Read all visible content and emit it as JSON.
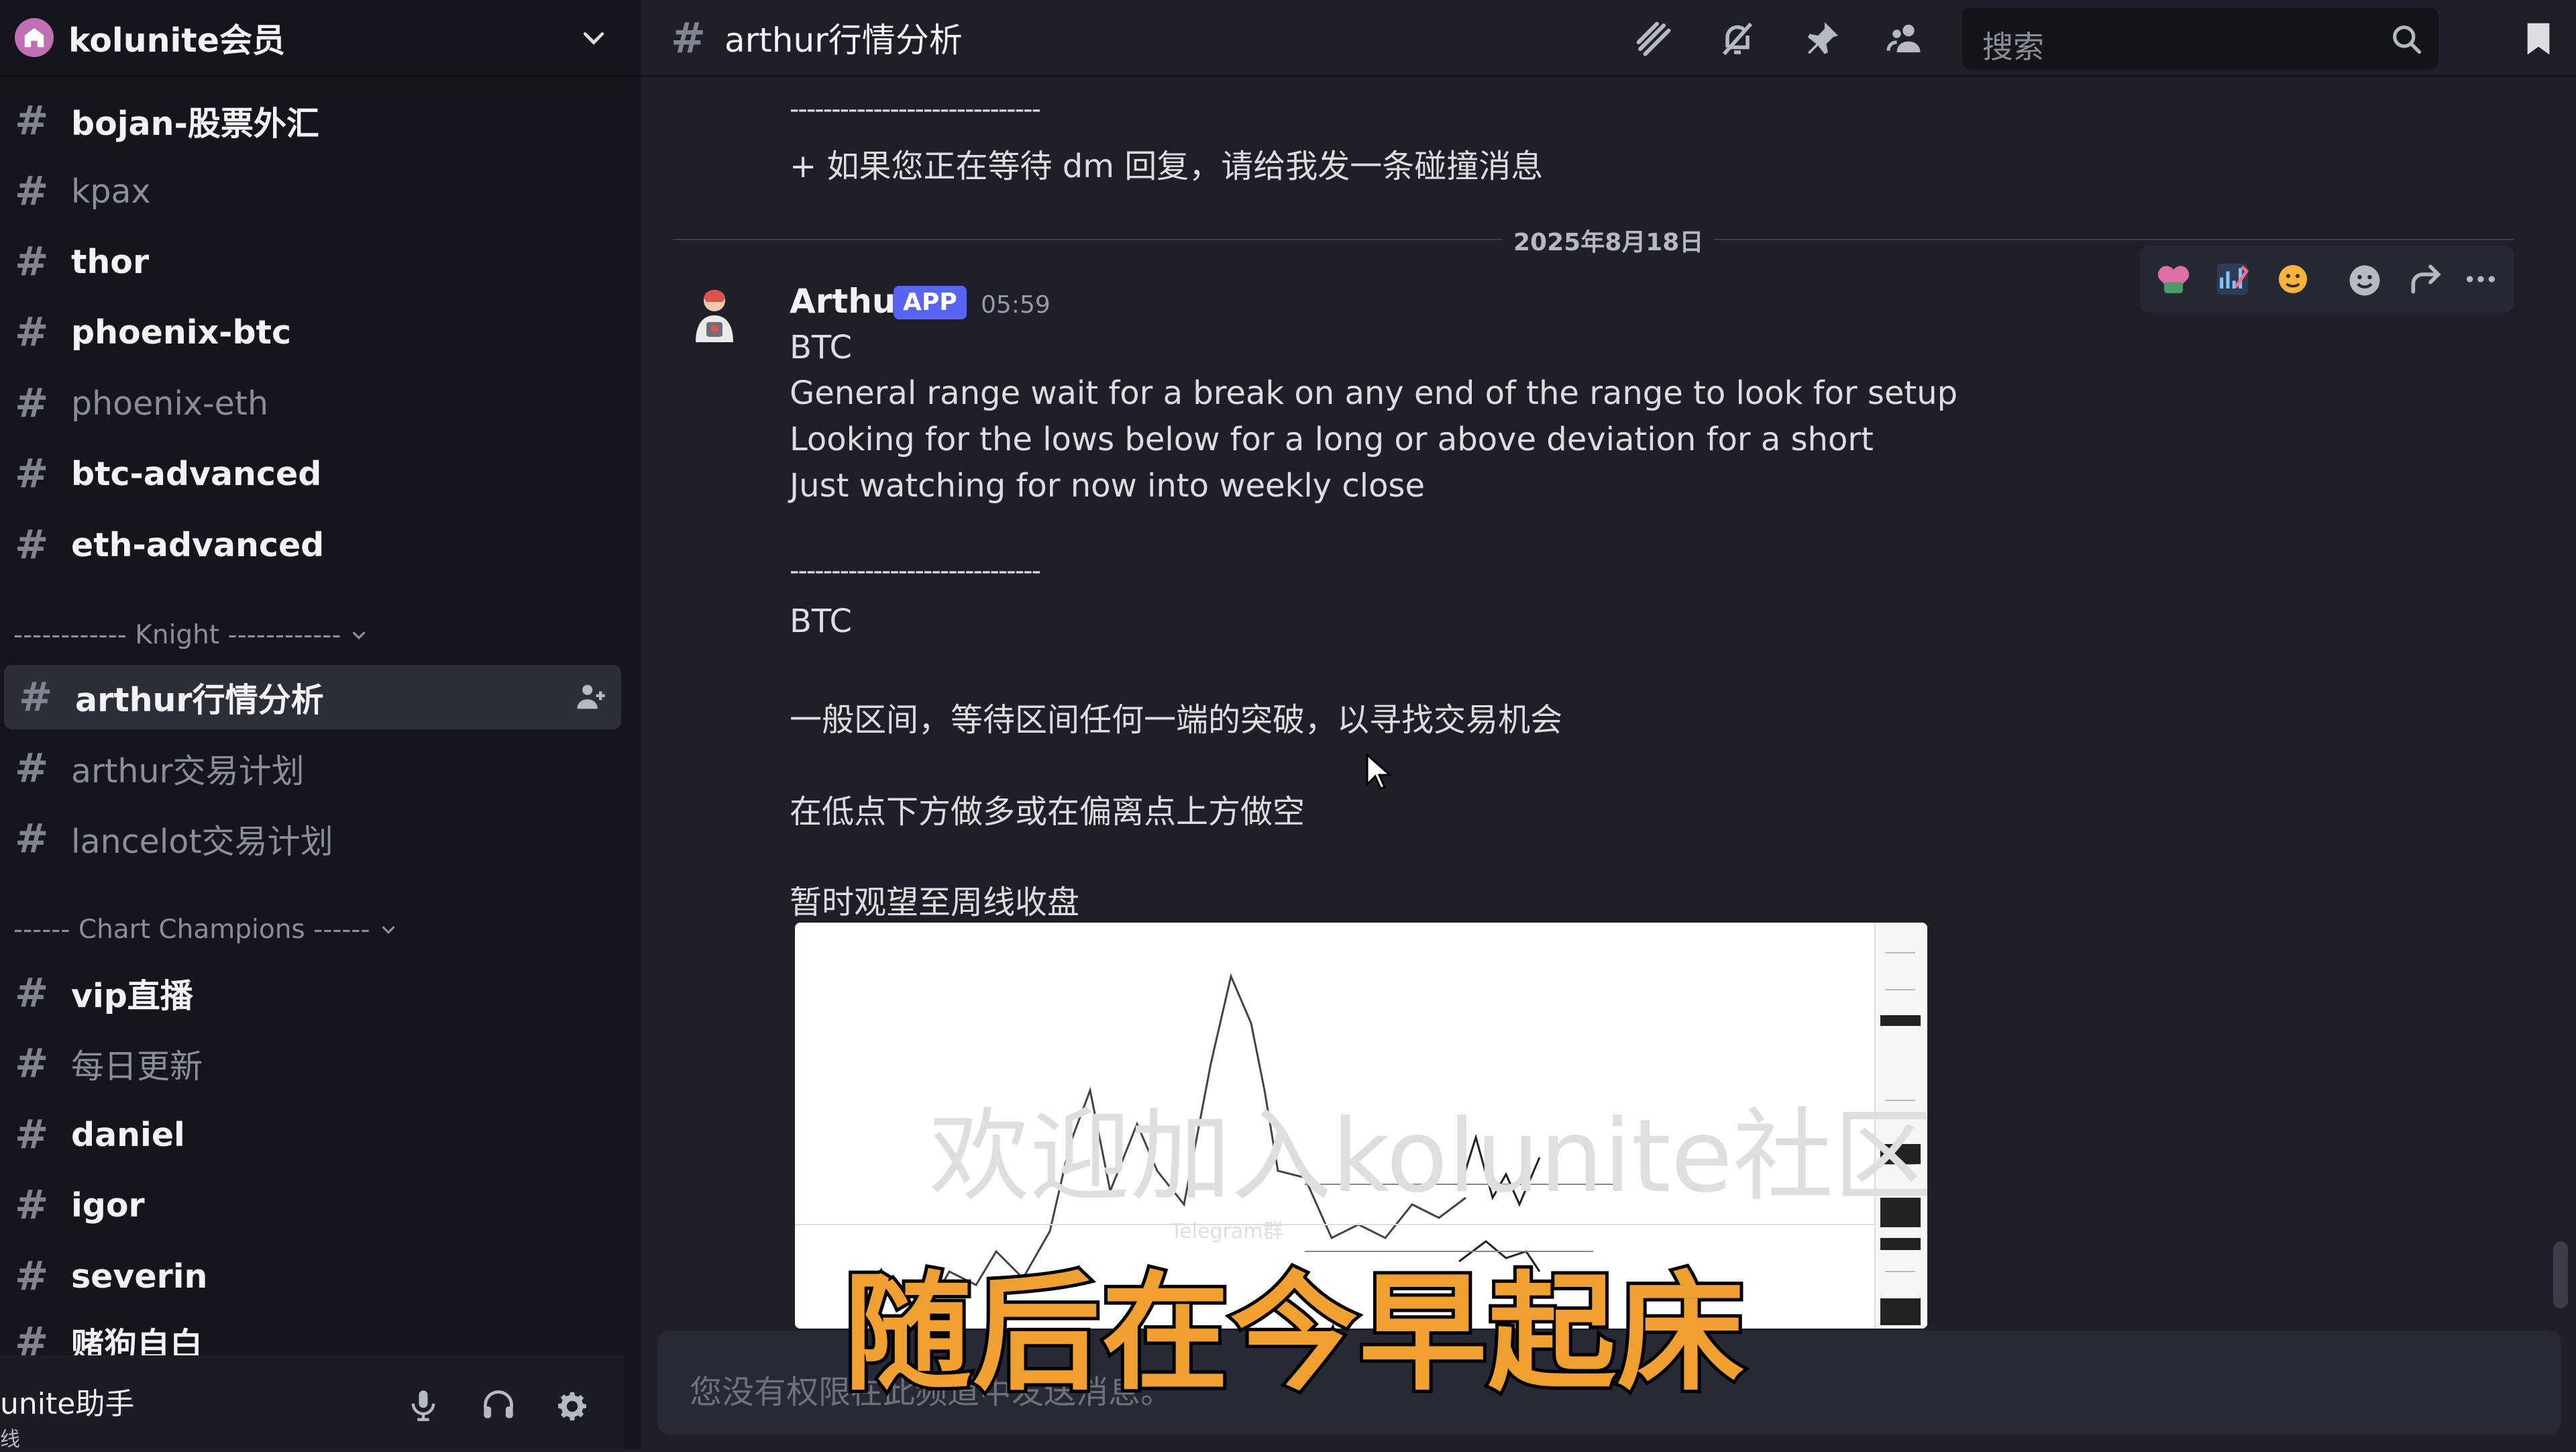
{
  "server": {
    "name": "kolunite会员"
  },
  "sidebar": {
    "channels_top": [
      {
        "label": "bojan-股票外汇",
        "state": "unread"
      },
      {
        "label": "kpax",
        "state": "read"
      },
      {
        "label": "thor",
        "state": "unread"
      },
      {
        "label": "phoenix-btc",
        "state": "unread"
      },
      {
        "label": "phoenix-eth",
        "state": "read"
      },
      {
        "label": "btc-advanced",
        "state": "unread"
      },
      {
        "label": "eth-advanced",
        "state": "unread"
      }
    ],
    "category_knight": "------------ Knight ------------",
    "channels_knight": [
      {
        "label": "arthur行情分析",
        "state": "active"
      },
      {
        "label": "arthur交易计划",
        "state": "read"
      },
      {
        "label": "lancelot交易计划",
        "state": "read"
      }
    ],
    "category_cc": "------ Chart Champions ------",
    "channels_cc": [
      {
        "label": "vip直播",
        "state": "unread"
      },
      {
        "label": "每日更新",
        "state": "read"
      },
      {
        "label": "daniel",
        "state": "unread"
      },
      {
        "label": "igor",
        "state": "unread"
      },
      {
        "label": "severin",
        "state": "unread"
      },
      {
        "label": "赌狗自白",
        "state": "unread"
      }
    ]
  },
  "user_panel": {
    "name": "unite助手",
    "status": "线"
  },
  "header": {
    "channel_name": "arthur行情分析",
    "search_placeholder": "搜索"
  },
  "messages": {
    "prev_separator": "------------------------------",
    "prev_line": "+ 如果您正在等待 dm 回复，请给我发一条碰撞消息",
    "date_divider": "2025年8月18日",
    "author": "Arthur",
    "badge": "APP",
    "time": "05:59",
    "lines_en": [
      "BTC",
      "General range wait for a break on any end of the range to look for setup",
      "Looking for the lows below for a long or above deviation for a short",
      "Just watching for now into weekly close"
    ],
    "separator": "------------------------------",
    "lines_zh": [
      "BTC",
      "一般区间，等待区间任何一端的突破，以寻找交易机会",
      "在低点下方做多或在偏离点上方做空",
      "暂时观望至周线收盘"
    ],
    "attachment_watermark": "欢迎加入kolunite社区",
    "attachment_sub": "Telegram群"
  },
  "composer": {
    "placeholder": "您没有权限在此频道中发送消息。"
  },
  "subtitle": "随后在今早起床",
  "colors": {
    "accent": "#5865f2",
    "subtitle": "#f0a030",
    "server_icon": "#c06fb5"
  }
}
